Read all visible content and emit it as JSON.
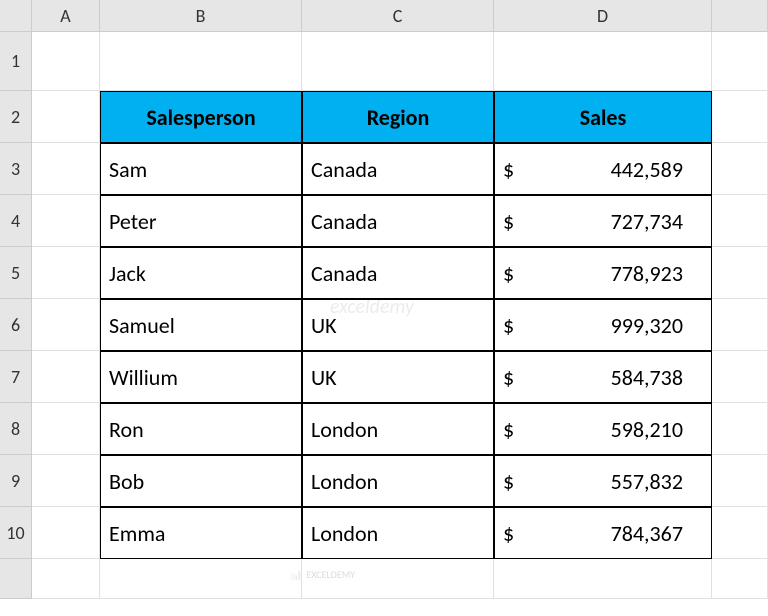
{
  "columns": [
    "",
    "A",
    "B",
    "C",
    "D",
    ""
  ],
  "rows": [
    "1",
    "2",
    "3",
    "4",
    "5",
    "6",
    "7",
    "8",
    "9",
    "10",
    ""
  ],
  "headers": {
    "b": "Salesperson",
    "c": "Region",
    "d": "Sales"
  },
  "currency_symbol": "$",
  "data": [
    {
      "name": "Sam",
      "region": "Canada",
      "sales": "442,589"
    },
    {
      "name": "Peter",
      "region": "Canada",
      "sales": "727,734"
    },
    {
      "name": "Jack",
      "region": "Canada",
      "sales": "778,923"
    },
    {
      "name": "Samuel",
      "region": "UK",
      "sales": "999,320"
    },
    {
      "name": "Willium",
      "region": "UK",
      "sales": "584,738"
    },
    {
      "name": "Ron",
      "region": "London",
      "sales": "598,210"
    },
    {
      "name": "Bob",
      "region": "London",
      "sales": "557,832"
    },
    {
      "name": "Emma",
      "region": "London",
      "sales": "784,367"
    }
  ],
  "watermark": "exceldemy",
  "watermark2": "EXCELDEMY"
}
